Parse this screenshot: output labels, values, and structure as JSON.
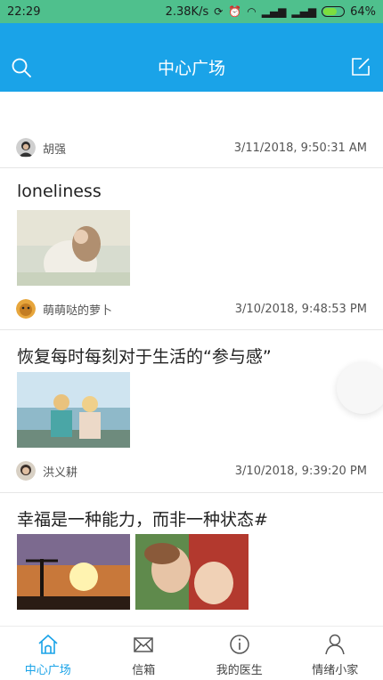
{
  "status_bar": {
    "time": "22:29",
    "speed": "2.38K/s",
    "battery": "64%",
    "battery_level": 0.64
  },
  "header": {
    "title": "中心广场"
  },
  "posts": [
    {
      "title": "loneliness",
      "author": "萌萌哒的萝卜",
      "time": "3/10/2018, 9:48:53 PM"
    },
    {
      "title": "恢复每时每刻对于生活的“参与感”",
      "author": "洪义耕",
      "time": "3/10/2018, 9:39:20 PM"
    },
    {
      "title": "幸福是一种能力，而非一种状态#",
      "author": "",
      "time": ""
    }
  ],
  "top_author": {
    "author": "胡强",
    "time": "3/11/2018, 9:50:31 AM"
  },
  "tabs": [
    {
      "label": "中心广场",
      "icon": "home-icon",
      "active": true
    },
    {
      "label": "信箱",
      "icon": "mail-icon",
      "active": false
    },
    {
      "label": "我的医生",
      "icon": "info-icon",
      "active": false
    },
    {
      "label": "情绪小家",
      "icon": "person-icon",
      "active": false
    }
  ],
  "colors": {
    "accent": "#1aa3e8",
    "status_bar": "#4fc08d"
  }
}
